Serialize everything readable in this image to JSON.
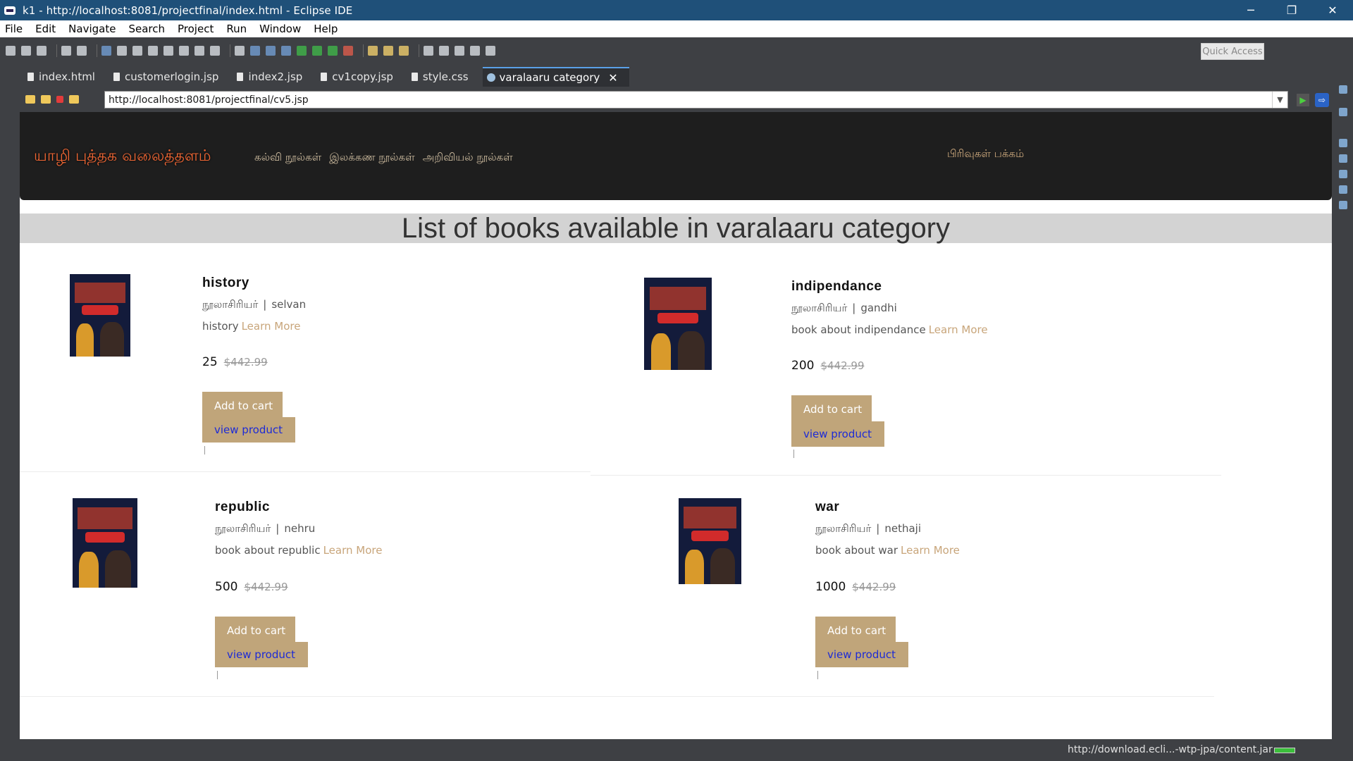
{
  "window": {
    "title": "k1 - http://localhost:8081/projectfinal/index.html - Eclipse IDE",
    "minimize": "─",
    "maximize": "❐",
    "close": "✕"
  },
  "menu": [
    "File",
    "Edit",
    "Navigate",
    "Search",
    "Project",
    "Run",
    "Window",
    "Help"
  ],
  "toolbar": {
    "quick_access": "Quick Access"
  },
  "tabs": [
    {
      "label": "index.html"
    },
    {
      "label": "customerlogin.jsp"
    },
    {
      "label": "index2.jsp"
    },
    {
      "label": "cv1copy.jsp"
    },
    {
      "label": "style.css"
    },
    {
      "label": "varalaaru category",
      "close": "✕"
    }
  ],
  "browser": {
    "url": "http://localhost:8081/projectfinal/cv5.jsp",
    "dropdown": "▼",
    "go": "▶",
    "external": "⇨"
  },
  "site": {
    "brand": "யாழி புத்தக வலைத்தளம்",
    "nav": [
      "கல்வி நூல்கள்",
      "இலக்கண நூல்கள்",
      "அறிவியல் நூல்கள்"
    ],
    "nav_right": "பிரிவுகள் பக்கம்",
    "heading": "List of books available in varalaaru category"
  },
  "products": [
    {
      "name": "history",
      "author_label": "நூலாசிரியர்",
      "sep": "|",
      "author": "selvan",
      "desc": "history",
      "learn_more": "Learn More",
      "price": "25",
      "old_price": "$442.99",
      "add_to_cart": "Add to cart",
      "view_product": "view product"
    },
    {
      "name": "indipendance",
      "author_label": "நூலாசிரியர்",
      "sep": "|",
      "author": "gandhi",
      "desc": "book about indipendance",
      "learn_more": "Learn More",
      "price": "200",
      "old_price": "$442.99",
      "add_to_cart": "Add to cart",
      "view_product": "view product"
    },
    {
      "name": "republic",
      "author_label": "நூலாசிரியர்",
      "sep": "|",
      "author": "nehru",
      "desc": "book about republic",
      "learn_more": "Learn More",
      "price": "500",
      "old_price": "$442.99",
      "add_to_cart": "Add to cart",
      "view_product": "view product"
    },
    {
      "name": "war",
      "author_label": "நூலாசிரியர்",
      "sep": "|",
      "author": "nethaji",
      "desc": "book about war",
      "learn_more": "Learn More",
      "price": "1000",
      "old_price": "$442.99",
      "add_to_cart": "Add to cart",
      "view_product": "view product"
    }
  ],
  "status": {
    "text": "http://download.ecli...-wtp-jpa/content.jar"
  }
}
